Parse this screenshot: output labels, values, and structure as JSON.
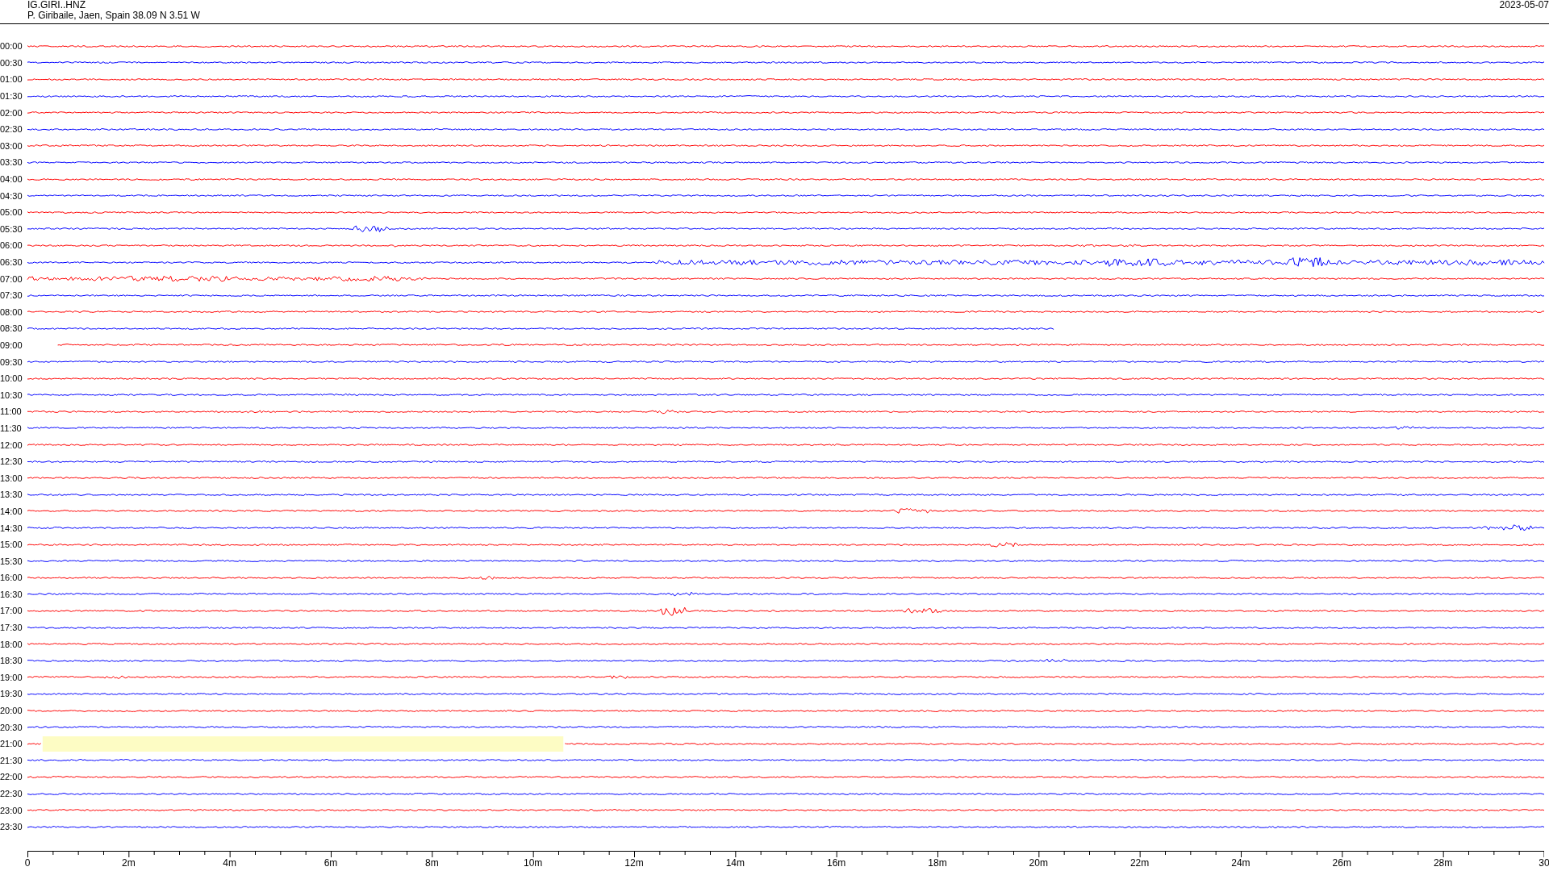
{
  "header": {
    "station": "IG.GIRI..HNZ",
    "location": "P. Giribaile, Jaen, Spain  38.09 N 3.51 W",
    "date": "2023-05-07"
  },
  "rows": [
    {
      "label": "00:00",
      "color": "#ff0000"
    },
    {
      "label": "00:30",
      "color": "#0000ff"
    },
    {
      "label": "01:00",
      "color": "#ff0000"
    },
    {
      "label": "01:30",
      "color": "#0000ff"
    },
    {
      "label": "02:00",
      "color": "#ff0000"
    },
    {
      "label": "02:30",
      "color": "#0000ff"
    },
    {
      "label": "03:00",
      "color": "#ff0000"
    },
    {
      "label": "03:30",
      "color": "#0000ff"
    },
    {
      "label": "04:00",
      "color": "#ff0000"
    },
    {
      "label": "04:30",
      "color": "#0000ff"
    },
    {
      "label": "05:00",
      "color": "#ff0000"
    },
    {
      "label": "05:30",
      "color": "#0000ff"
    },
    {
      "label": "06:00",
      "color": "#ff0000"
    },
    {
      "label": "06:30",
      "color": "#0000ff"
    },
    {
      "label": "07:00",
      "color": "#ff0000"
    },
    {
      "label": "07:30",
      "color": "#0000ff"
    },
    {
      "label": "08:00",
      "color": "#ff0000"
    },
    {
      "label": "08:30",
      "color": "#0000ff"
    },
    {
      "label": "09:00",
      "color": "#ff0000"
    },
    {
      "label": "09:30",
      "color": "#0000ff"
    },
    {
      "label": "10:00",
      "color": "#ff0000"
    },
    {
      "label": "10:30",
      "color": "#0000ff"
    },
    {
      "label": "11:00",
      "color": "#ff0000"
    },
    {
      "label": "11:30",
      "color": "#0000ff"
    },
    {
      "label": "12:00",
      "color": "#ff0000"
    },
    {
      "label": "12:30",
      "color": "#0000ff"
    },
    {
      "label": "13:00",
      "color": "#ff0000"
    },
    {
      "label": "13:30",
      "color": "#0000ff"
    },
    {
      "label": "14:00",
      "color": "#ff0000"
    },
    {
      "label": "14:30",
      "color": "#0000ff"
    },
    {
      "label": "15:00",
      "color": "#ff0000"
    },
    {
      "label": "15:30",
      "color": "#0000ff"
    },
    {
      "label": "16:00",
      "color": "#ff0000"
    },
    {
      "label": "16:30",
      "color": "#0000ff"
    },
    {
      "label": "17:00",
      "color": "#ff0000"
    },
    {
      "label": "17:30",
      "color": "#0000ff"
    },
    {
      "label": "18:00",
      "color": "#ff0000"
    },
    {
      "label": "18:30",
      "color": "#0000ff"
    },
    {
      "label": "19:00",
      "color": "#ff0000"
    },
    {
      "label": "19:30",
      "color": "#0000ff"
    },
    {
      "label": "20:00",
      "color": "#ff0000"
    },
    {
      "label": "20:30",
      "color": "#0000ff"
    },
    {
      "label": "21:00",
      "color": "#ff0000"
    },
    {
      "label": "21:30",
      "color": "#0000ff"
    },
    {
      "label": "22:00",
      "color": "#ff0000"
    },
    {
      "label": "22:30",
      "color": "#0000ff"
    },
    {
      "label": "23:00",
      "color": "#ff0000"
    },
    {
      "label": "23:30",
      "color": "#0000ff"
    }
  ],
  "axis": {
    "labels": [
      "0",
      "2m",
      "4m",
      "6m",
      "8m",
      "10m",
      "12m",
      "14m",
      "16m",
      "18m",
      "20m",
      "22m",
      "24m",
      "26m",
      "28m",
      "30"
    ]
  }
}
